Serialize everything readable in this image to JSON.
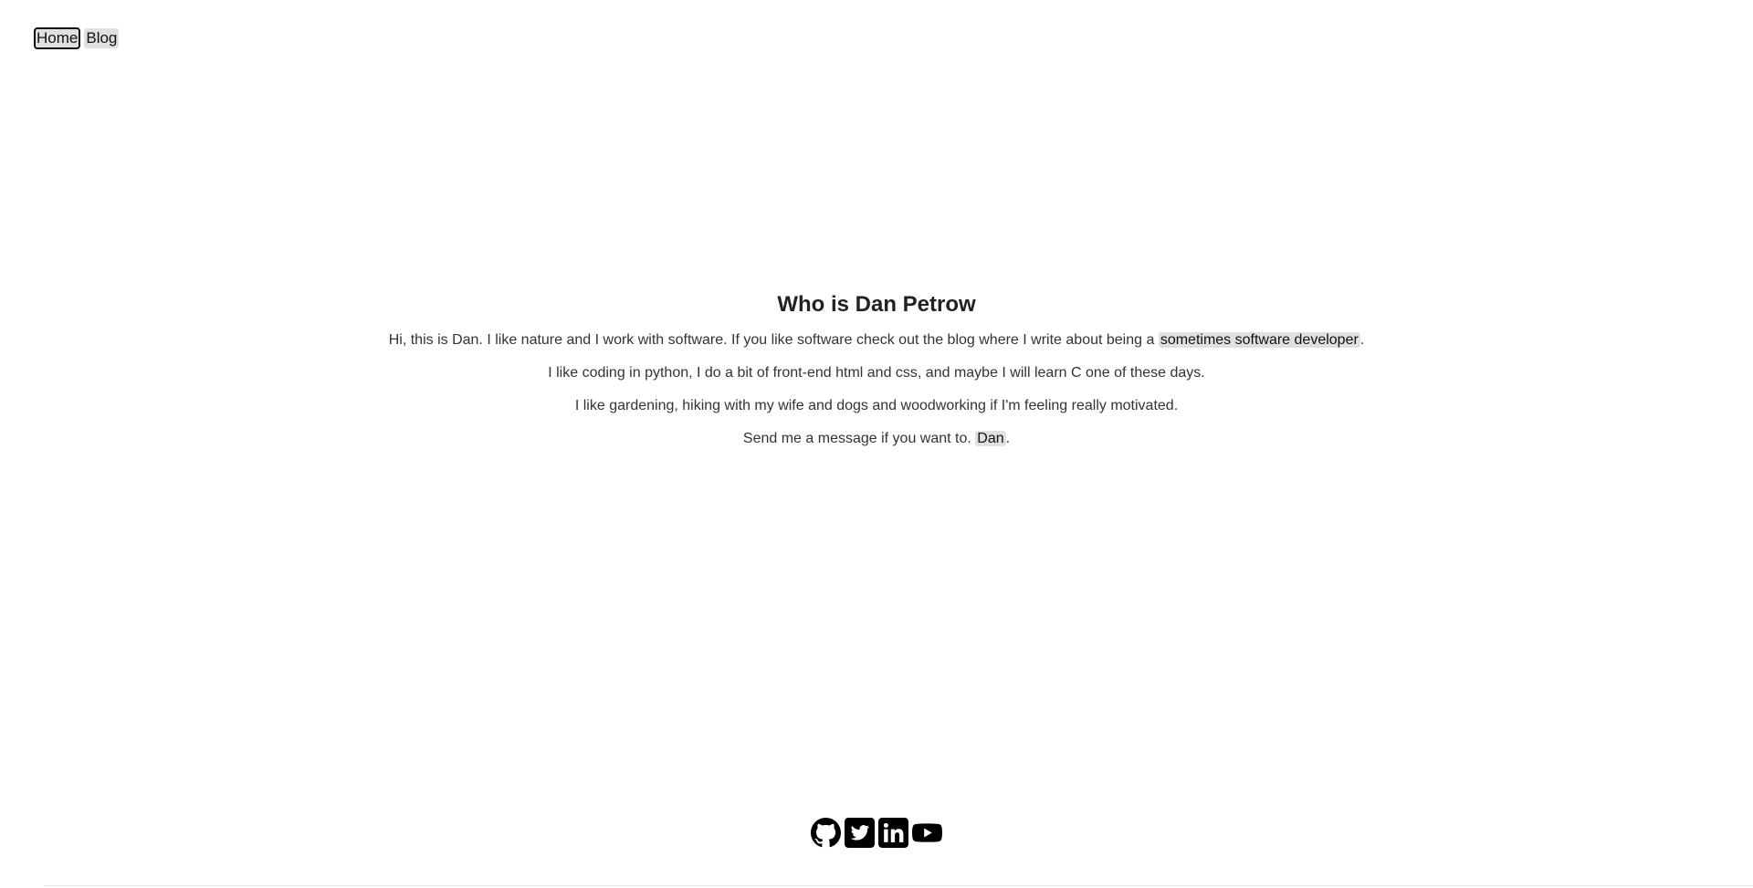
{
  "nav": {
    "home_label": "Home",
    "blog_label": "Blog"
  },
  "main": {
    "title": "Who is Dan Petrow",
    "para1_prefix": "Hi, this is Dan. I like nature and I work with software. If you like software check out the blog where I write about being a ",
    "para1_link": "sometimes software developer",
    "para1_suffix": ".",
    "para2": "I like coding in python, I do a bit of front-end html and css, and maybe I will learn C one of these days.",
    "para3": "I like gardening, hiking with my wife and dogs and woodworking if I'm feeling really motivated.",
    "para4_prefix": "Send me a message if you want to. ",
    "para4_link": "Dan",
    "para4_suffix": "."
  },
  "social": {
    "icons": [
      "github-icon",
      "twitter-icon",
      "linkedin-icon",
      "youtube-icon"
    ]
  },
  "colors": {
    "link_background": "#e0e0e0",
    "text": "#333333",
    "icon": "#000000"
  }
}
